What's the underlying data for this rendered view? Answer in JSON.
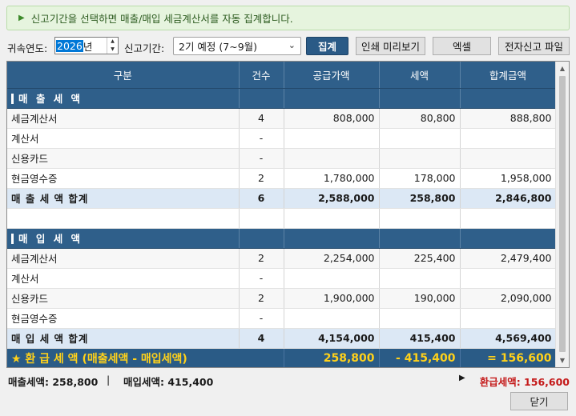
{
  "banner": {
    "icon": "play-triangle-icon",
    "text": "신고기간을 선택하면 매출/매입 세금계산서를 자동 집계합니다."
  },
  "toolbar": {
    "year_label": "귀속연도:",
    "year_value": "2026",
    "year_suffix": "년",
    "period_label": "신고기간:",
    "period_value": "2기 예정 (7~9월)",
    "aggregate_button": "집계",
    "print_preview_button": "인쇄 미리보기",
    "excel_button": "엑셀",
    "efile_button": "전자신고 파일"
  },
  "table": {
    "headers": [
      "구분",
      "건수",
      "공급가액",
      "세액",
      "합계금액"
    ],
    "sales_section": "매 출 세 액",
    "sales_rows": [
      {
        "label": "세금계산서",
        "count": "4",
        "supply": "808,000",
        "tax": "80,800",
        "total": "888,800"
      },
      {
        "label": "계산서",
        "count": "-",
        "supply": "",
        "tax": "",
        "total": ""
      },
      {
        "label": "신용카드",
        "count": "-",
        "supply": "",
        "tax": "",
        "total": ""
      },
      {
        "label": "현금영수증",
        "count": "2",
        "supply": "1,780,000",
        "tax": "178,000",
        "total": "1,958,000"
      }
    ],
    "sales_total": {
      "label": "매 출 세 액 합계",
      "count": "6",
      "supply": "2,588,000",
      "tax": "258,800",
      "total": "2,846,800"
    },
    "purchase_section": "매 입 세 액",
    "purchase_rows": [
      {
        "label": "세금계산서",
        "count": "2",
        "supply": "2,254,000",
        "tax": "225,400",
        "total": "2,479,400"
      },
      {
        "label": "계산서",
        "count": "-",
        "supply": "",
        "tax": "",
        "total": ""
      },
      {
        "label": "신용카드",
        "count": "2",
        "supply": "1,900,000",
        "tax": "190,000",
        "total": "2,090,000"
      },
      {
        "label": "현금영수증",
        "count": "-",
        "supply": "",
        "tax": "",
        "total": ""
      }
    ],
    "purchase_total": {
      "label": "매 입 세 액 합계",
      "count": "4",
      "supply": "4,154,000",
      "tax": "415,400",
      "total": "4,569,400"
    },
    "refund": {
      "label": "★ 환 급 세 액 (매출세액 - 매입세액)",
      "supply": "258,800",
      "tax": "- 415,400",
      "total": "= 156,600"
    }
  },
  "summary": {
    "sales_tax": "매출세액: 258,800",
    "separator": "|",
    "purchase_tax": "매입세액: 415,400",
    "refund_marker": "▶",
    "refund_tax": "환급세액: 156,600"
  },
  "close_button": "닫기",
  "colors": {
    "header": "#2f5f8a",
    "total_row": "#dce8f5",
    "refund_text": "#ffd11a",
    "refund_summary": "#c41a1a",
    "banner_bg": "#e6f4de"
  }
}
